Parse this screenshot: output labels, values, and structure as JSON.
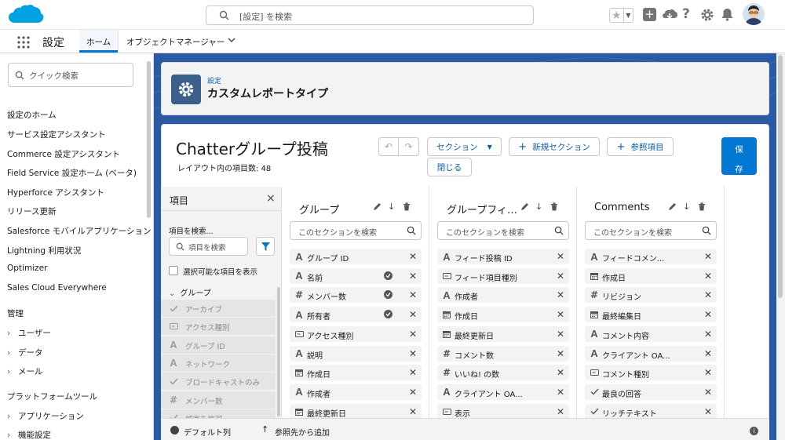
{
  "topbar": {
    "search_placeholder": "[設定] を検索"
  },
  "navbar": {
    "app_name": "設定",
    "tabs": [
      {
        "label": "ホーム"
      },
      {
        "label": "オブジェクトマネージャー"
      }
    ]
  },
  "sidebar": {
    "quick_find_placeholder": "クイック検索",
    "items": [
      "設定のホーム",
      "サービス設定アシスタント",
      "Commerce 設定アシスタント",
      "Field Service 設定ホーム (ベータ)",
      "Hyperforce アシスタント",
      "リリース更新",
      "Salesforce モバイルアプリケーション",
      "Lightning 利用状況",
      "Optimizer",
      "Sales Cloud Everywhere"
    ],
    "section_admin": "管理",
    "admin_items": [
      "ユーザー",
      "データ",
      "メール"
    ],
    "section_platform": "プラットフォームツール",
    "platform_items": [
      "アプリケーション",
      "機能設定"
    ]
  },
  "header": {
    "breadcrumb": "設定",
    "title": "カスタムレポートタイプ"
  },
  "editor": {
    "title": "Chatterグループ投稿",
    "field_count": "レイアウト内の項目数: 48",
    "section_button": "セクション",
    "new_section_button": "新規セクション",
    "lookup_button": "参照項目",
    "close_button": "閉じる",
    "save_button_1": "保",
    "save_button_2": "存"
  },
  "palette": {
    "title": "項目",
    "search_label": "項目を検索...",
    "search_placeholder": "項目を検索",
    "show_selectable": "選択可能な項目を表示",
    "group_label": "グループ",
    "items": [
      {
        "label": "アーカイブ",
        "icon": "check-icon"
      },
      {
        "label": "アクセス種別",
        "icon": "picklist-icon"
      },
      {
        "label": "グループ ID",
        "icon": "text-icon"
      },
      {
        "label": "ネットワーク",
        "icon": "text-icon"
      },
      {
        "label": "ブロードキャストのみ",
        "icon": "check-icon"
      },
      {
        "label": "メンバー数",
        "icon": "number-icon"
      },
      {
        "label": "顧客を許可",
        "icon": "check-icon"
      }
    ]
  },
  "sections": [
    {
      "title": "グループ",
      "search_placeholder": "このセクションを検索",
      "fields": [
        {
          "label": "グループ ID",
          "icon": "text-icon",
          "checked": false
        },
        {
          "label": "名前",
          "icon": "text-icon",
          "checked": true
        },
        {
          "label": "メンバー数",
          "icon": "number-icon",
          "checked": true
        },
        {
          "label": "所有者",
          "icon": "text-icon",
          "checked": true
        },
        {
          "label": "アクセス種別",
          "icon": "picklist-icon",
          "checked": false
        },
        {
          "label": "説明",
          "icon": "text-icon",
          "checked": false
        },
        {
          "label": "作成日",
          "icon": "date-icon",
          "checked": false
        },
        {
          "label": "作成者",
          "icon": "text-icon",
          "checked": false
        },
        {
          "label": "最終更新日",
          "icon": "date-icon",
          "checked": false
        }
      ]
    },
    {
      "title": "グループフィ…",
      "search_placeholder": "このセクションを検索",
      "fields": [
        {
          "label": "フィード投稿 ID",
          "icon": "text-icon",
          "checked": false
        },
        {
          "label": "フィード項目種別",
          "icon": "picklist-icon",
          "checked": false
        },
        {
          "label": "作成者",
          "icon": "text-icon",
          "checked": false
        },
        {
          "label": "作成日",
          "icon": "date-icon",
          "checked": false
        },
        {
          "label": "最終更新日",
          "icon": "date-icon",
          "checked": false
        },
        {
          "label": "コメント数",
          "icon": "number-icon",
          "checked": false
        },
        {
          "label": "いいね! の数",
          "icon": "number-icon",
          "checked": false
        },
        {
          "label": "クライアント OA...",
          "icon": "text-icon",
          "checked": false
        },
        {
          "label": "表示",
          "icon": "picklist-icon",
          "checked": false
        }
      ]
    },
    {
      "title": "Comments",
      "search_placeholder": "このセクションを検索",
      "fields": [
        {
          "label": "フィードコメン...",
          "icon": "text-icon",
          "checked": false
        },
        {
          "label": "作成日",
          "icon": "date-icon",
          "checked": false
        },
        {
          "label": "リビジョン",
          "icon": "number-icon",
          "checked": false
        },
        {
          "label": "最終編集日",
          "icon": "date-icon",
          "checked": false
        },
        {
          "label": "コメント内容",
          "icon": "text-icon",
          "checked": false
        },
        {
          "label": "クライアント OA...",
          "icon": "text-icon",
          "checked": false
        },
        {
          "label": "コメント種別",
          "icon": "picklist-icon",
          "checked": false
        },
        {
          "label": "最良の回答",
          "icon": "check-icon",
          "checked": false
        },
        {
          "label": "リッチテキスト",
          "icon": "check-icon",
          "checked": false
        }
      ]
    }
  ],
  "footer": {
    "default_columns": "デフォルト列",
    "add_from_lookup": "参照先から追加"
  },
  "colors": {
    "brand_blue": "#0176d3",
    "link_blue": "#0b5cab",
    "banner_blue": "#2a5aa3",
    "setup_icon_bg": "#3a5f8a"
  }
}
